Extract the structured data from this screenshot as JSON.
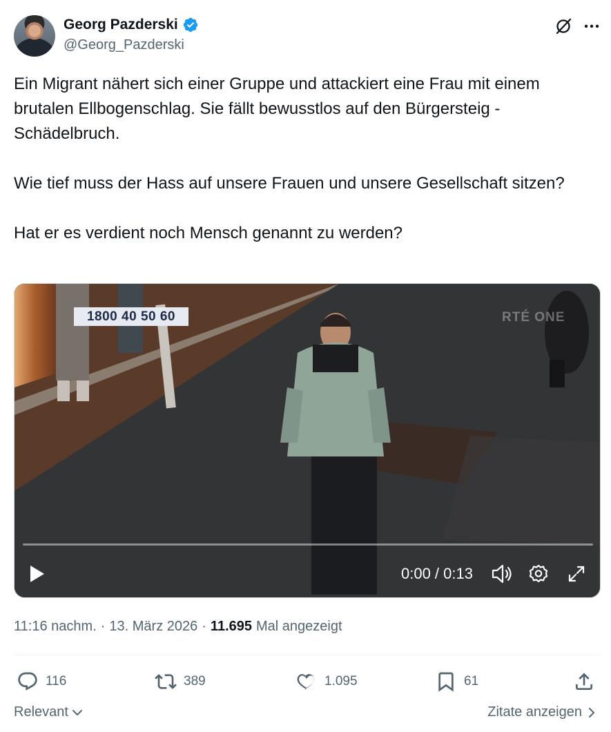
{
  "author": {
    "name": "Georg Pazderski",
    "handle": "@Georg_Pazderski",
    "verified_color": "#1d9bf0"
  },
  "tweet": {
    "paragraphs": [
      "Ein Migrant nähert sich einer Gruppe und attackiert eine Frau mit einem brutalen Ellbogenschlag. Sie fällt bewusstlos auf den Bürgersteig - Schädelbruch.",
      "Wie tief muss der Hass auf unsere Frauen und unsere Gesellschaft sitzen?",
      "Hat er es verdient noch Mensch genannt zu werden?"
    ]
  },
  "video": {
    "phone_label": "1800 40 50 60",
    "watermark": "RTÉ ONE",
    "time": "0:00 / 0:13",
    "progress": 0.0
  },
  "meta": {
    "time": "11:16 nachm.",
    "separator": "·",
    "date": "13. März 2026",
    "views": "11.695",
    "views_label": "Mal angezeigt"
  },
  "actions": {
    "replies": "116",
    "retweets": "389",
    "likes": "1.095",
    "bookmarks": "61"
  },
  "footer": {
    "sort_label": "Relevant",
    "quotes_label": "Zitate anzeigen"
  },
  "icons": {
    "top": [
      "grok-icon",
      "more-icon"
    ],
    "controls": [
      "play-icon",
      "volume-icon",
      "settings-icon",
      "fullscreen-icon"
    ],
    "actions": [
      "reply-icon",
      "retweet-icon",
      "like-icon",
      "bookmark-icon",
      "share-icon"
    ]
  },
  "colors": {
    "text": "#0f1419",
    "secondary": "#536471",
    "accent": "#1d9bf0"
  }
}
